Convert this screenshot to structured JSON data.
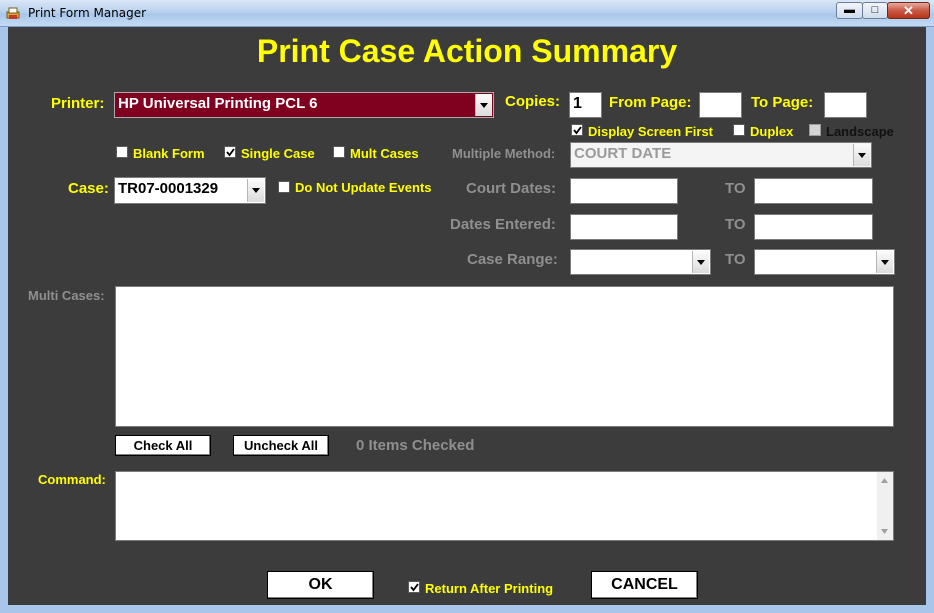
{
  "window": {
    "title": "Print Form Manager"
  },
  "heading": "Print Case Action Summary",
  "printer": {
    "label": "Printer:",
    "value": "HP Universal Printing PCL 6"
  },
  "copies": {
    "label": "Copies:",
    "value": "1"
  },
  "from_page": {
    "label": "From Page:",
    "value": ""
  },
  "to_page": {
    "label": "To Page:",
    "value": ""
  },
  "options": {
    "display_screen_first": {
      "label": "Display Screen First",
      "checked": true
    },
    "duplex": {
      "label": "Duplex",
      "checked": false
    },
    "landscape": {
      "label": "Landscape",
      "checked": false
    }
  },
  "mode": {
    "blank_form": {
      "label": "Blank Form",
      "checked": false
    },
    "single_case": {
      "label": "Single Case",
      "checked": true
    },
    "mult_cases": {
      "label": "Mult Cases",
      "checked": false
    }
  },
  "multiple_method": {
    "label": "Multiple Method:",
    "value": "COURT DATE"
  },
  "case": {
    "label": "Case:",
    "value": "TR07-0001329"
  },
  "do_not_update": {
    "label": "Do Not Update Events",
    "checked": false
  },
  "court_dates": {
    "label": "Court Dates:",
    "to": "TO",
    "from_value": "",
    "to_value": ""
  },
  "dates_entered": {
    "label": "Dates Entered:",
    "to": "TO",
    "from_value": "",
    "to_value": ""
  },
  "case_range": {
    "label": "Case Range:",
    "to": "TO",
    "from_value": "",
    "to_value": ""
  },
  "multi_cases": {
    "label": "Multi Cases:"
  },
  "check_all": "Check All",
  "uncheck_all": "Uncheck All",
  "items_checked": "0 Items Checked",
  "command": {
    "label": "Command:",
    "value": ""
  },
  "ok": "OK",
  "return_after_printing": {
    "label": "Return After Printing",
    "checked": true
  },
  "cancel": "CANCEL"
}
